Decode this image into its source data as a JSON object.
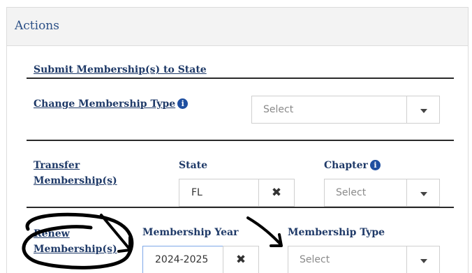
{
  "panel": {
    "title": "Actions"
  },
  "actions": {
    "submit": {
      "label": "Submit Membership(s) to State"
    },
    "change_type": {
      "label": "Change Membership Type",
      "info_icon": "info-icon",
      "select": {
        "value": "Select"
      }
    },
    "transfer": {
      "label_line1": "Transfer",
      "label_line2": "Membership(s)",
      "state": {
        "label": "State",
        "value": "FL",
        "clear_icon": "✖"
      },
      "chapter": {
        "label": "Chapter",
        "info_icon": "info-icon",
        "select": {
          "value": "Select"
        }
      }
    },
    "renew": {
      "label_line1": "Renew",
      "label_line2": "Membership(s)",
      "year": {
        "label": "Membership Year",
        "value": "2024-2025",
        "clear_icon": "✖"
      },
      "type": {
        "label": "Membership Type",
        "select": {
          "value": "Select"
        }
      }
    }
  },
  "colors": {
    "link": "#1f3a68",
    "info": "#1f4fa0",
    "header_bg": "#f3f3f3",
    "annotation": "#000000"
  },
  "icons": {
    "info": "info-icon",
    "clear": "close-icon",
    "dropdown": "chevron-down-icon"
  }
}
